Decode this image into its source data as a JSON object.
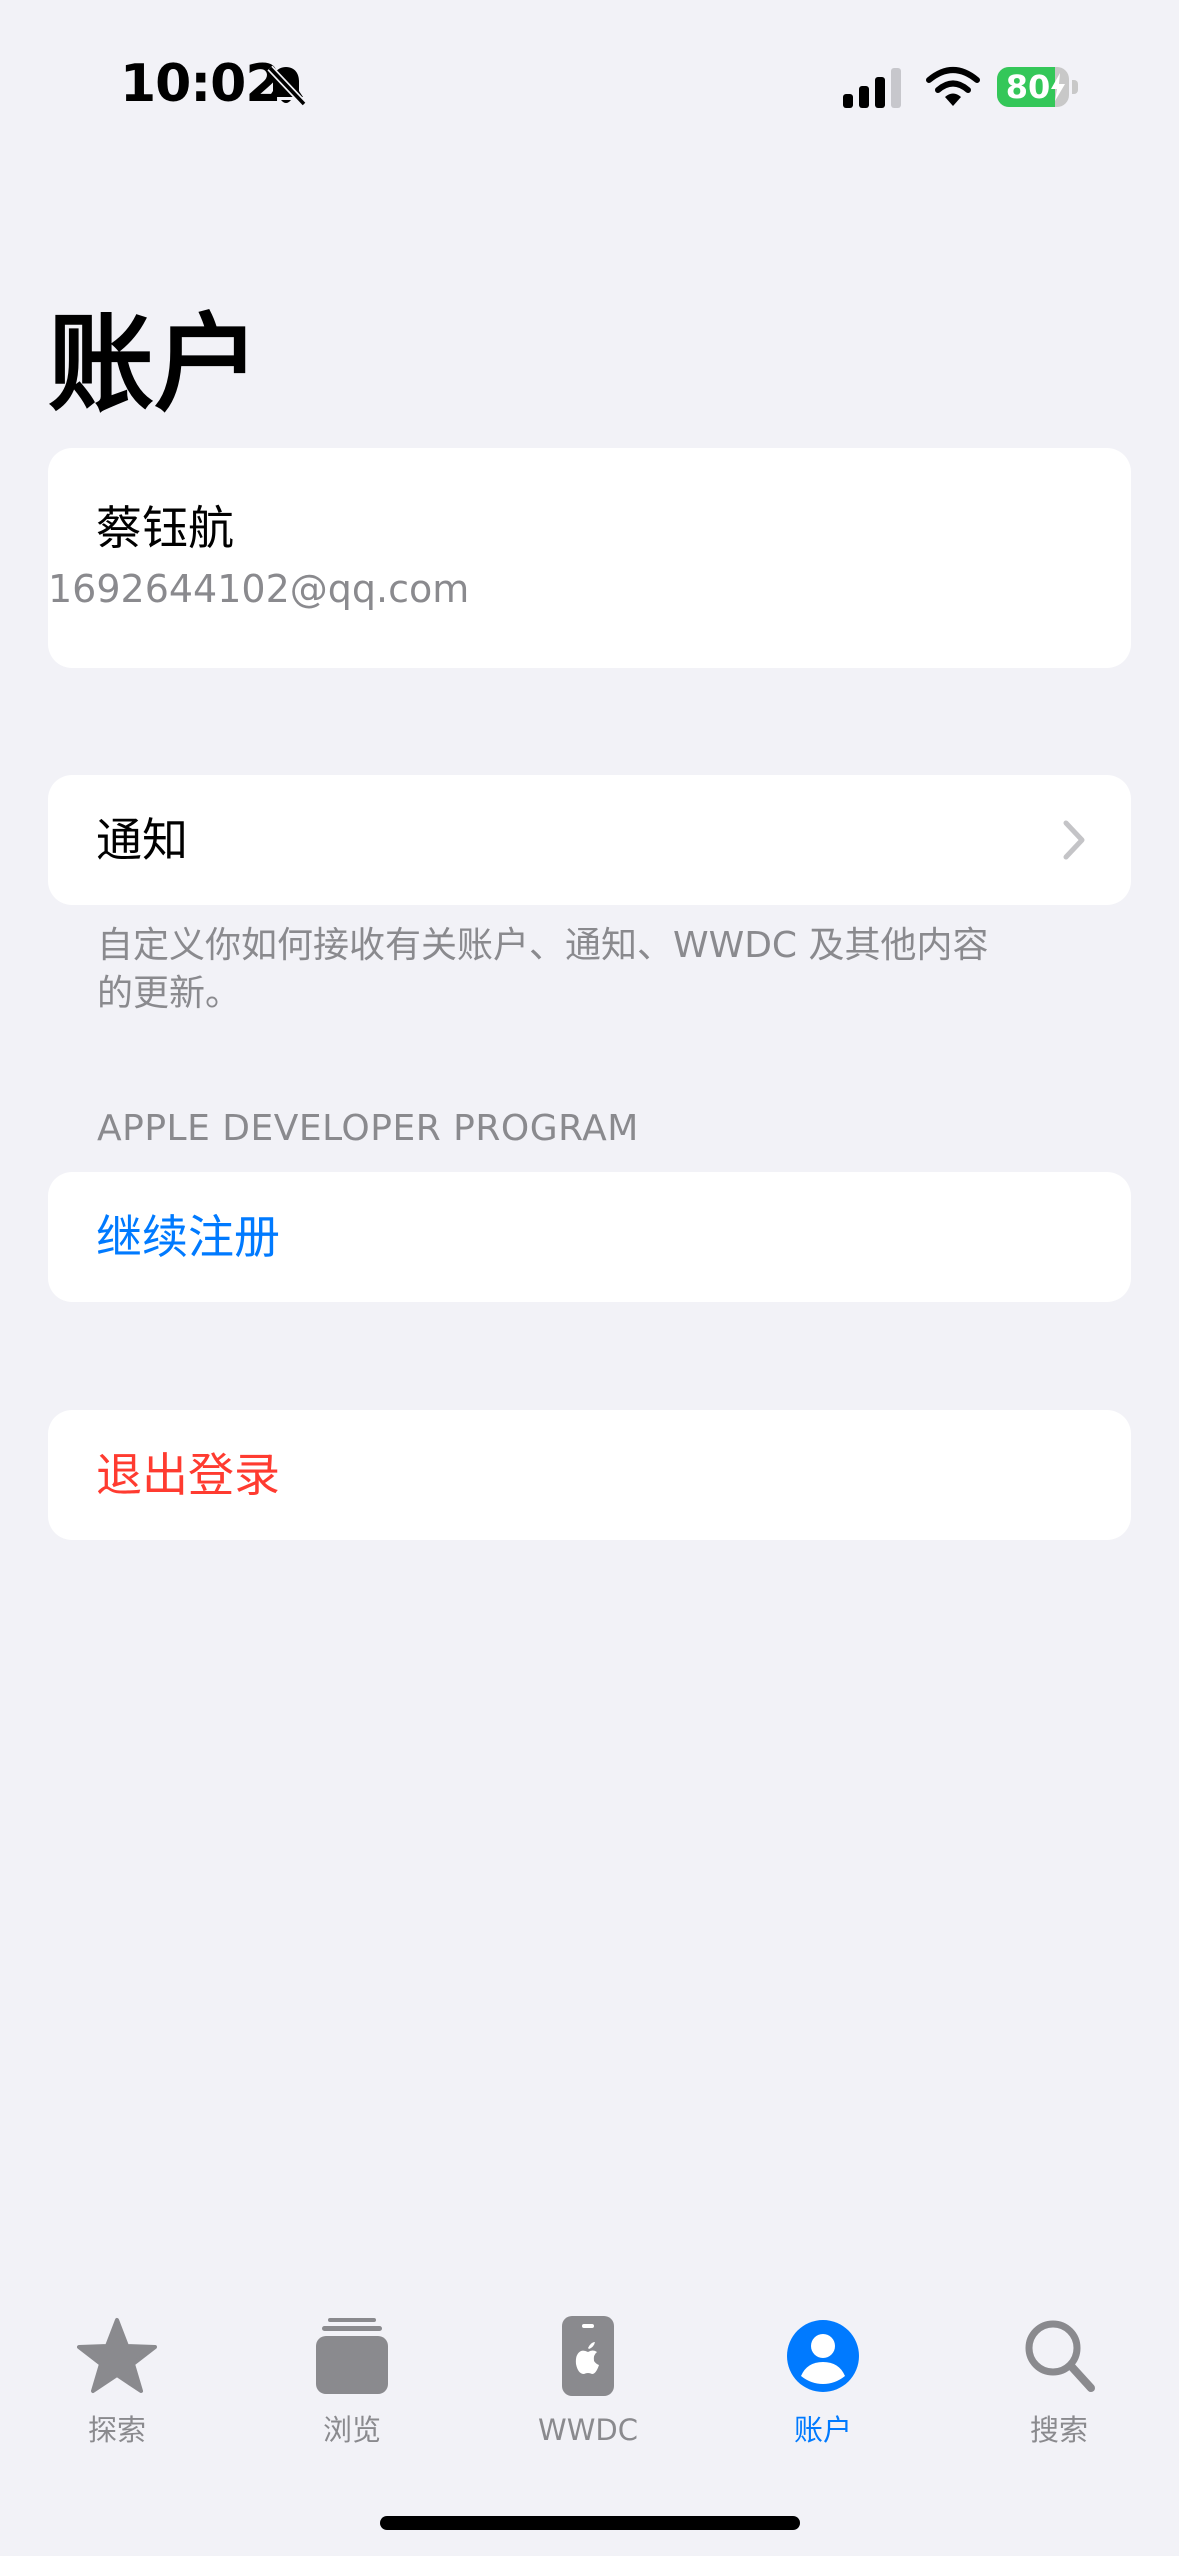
{
  "status_bar": {
    "time": "10:02",
    "battery_level": "80",
    "battery_fraction": 0.8,
    "battery_color": "#34c759",
    "icons": [
      "bell-slash-icon",
      "cellular-signal-icon",
      "wifi-icon",
      "battery-charging-icon"
    ]
  },
  "page_title": "账户",
  "user": {
    "name": "蔡钰航",
    "email": "1692644102@qq.com"
  },
  "notifications": {
    "label": "通知",
    "footnote": "自定义你如何接收有关账户、通知、WWDC 及其他内容的更新。"
  },
  "developer_program": {
    "header": "APPLE DEVELOPER PROGRAM",
    "continue_label": "继续注册"
  },
  "sign_out_label": "退出登录",
  "tabs": [
    {
      "label": "探索",
      "icon": "star-icon",
      "active": false
    },
    {
      "label": "浏览",
      "icon": "stack-icon",
      "active": false
    },
    {
      "label": "WWDC",
      "icon": "wwdc-icon",
      "active": false
    },
    {
      "label": "账户",
      "icon": "person-circle-icon",
      "active": true
    },
    {
      "label": "搜索",
      "icon": "magnifier-icon",
      "active": false
    }
  ],
  "colors": {
    "accent": "#007aff",
    "destructive": "#ff3b30",
    "background": "#f2f2f7",
    "secondary_text": "#8a8a8e"
  }
}
